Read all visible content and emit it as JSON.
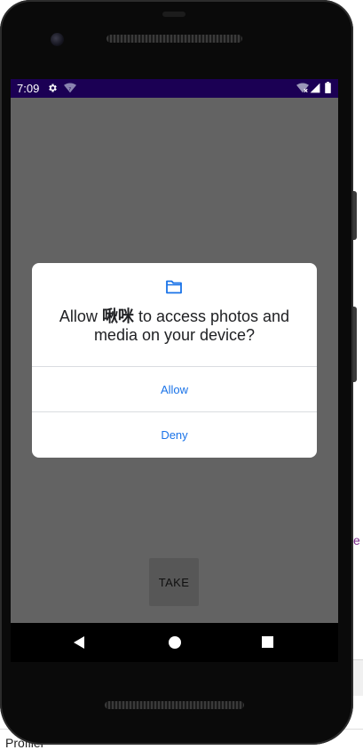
{
  "background": {
    "left_text": "Profiler",
    "right_text": "e"
  },
  "status_bar": {
    "time": "7:09",
    "icons": [
      "settings-icon",
      "wifi-icon",
      "wifi-off-icon",
      "cell-signal-icon",
      "battery-icon"
    ],
    "color": "#1b0054"
  },
  "screen": {
    "background_color": "#636363",
    "take_button_label": "TAKE"
  },
  "dialog": {
    "icon": "folder-icon",
    "message_prefix": "Allow ",
    "app_name": "啾咪",
    "message_suffix": " to access photos and media on your device?",
    "allow_label": "Allow",
    "deny_label": "Deny",
    "accent_color": "#1a73e8"
  },
  "nav_bar": {
    "buttons": [
      "back-icon",
      "home-icon",
      "recents-icon"
    ]
  }
}
